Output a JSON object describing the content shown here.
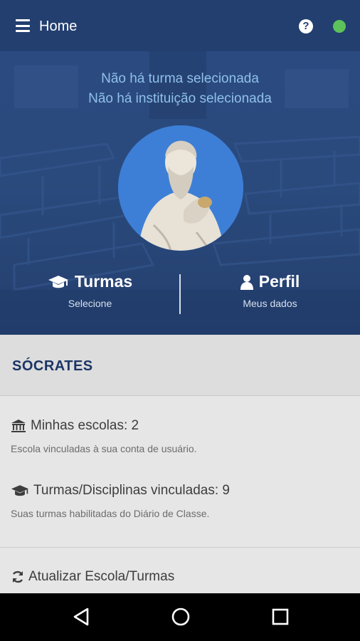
{
  "appbar": {
    "title": "Home",
    "menu_icon": "hamburger-menu-icon",
    "help_icon": "help-circle-icon",
    "help_glyph": "?",
    "status_color": "#5cc25a"
  },
  "hero": {
    "no_class": "Não há turma selecionada",
    "no_institution": "Não há instituição selecionada",
    "actions": [
      {
        "label": "Turmas",
        "sub": "Selecione",
        "icon": "graduation-cap-icon"
      },
      {
        "label": "Perfil",
        "sub": "Meus dados",
        "icon": "user-icon"
      }
    ]
  },
  "user": {
    "name": "SÓCRATES"
  },
  "info": {
    "schools": {
      "label": "Minhas escolas: 2",
      "desc": "Escola vinculadas à sua conta de usuário.",
      "icon": "institution-icon"
    },
    "classes": {
      "label": "Turmas/Disciplinas vinculadas: 9",
      "desc": "Suas turmas habilitadas do Diário de Classe.",
      "icon": "graduation-cap-icon"
    }
  },
  "refresh": {
    "label": "Atualizar Escola/Turmas",
    "icon": "refresh-icon"
  },
  "navbar": {
    "back_icon": "back-triangle-icon",
    "home_icon": "home-circle-icon",
    "recents_icon": "recents-square-icon"
  },
  "colors": {
    "primary": "#233f70",
    "accent_text": "#8fc0ea",
    "name_color": "#1c3566"
  }
}
